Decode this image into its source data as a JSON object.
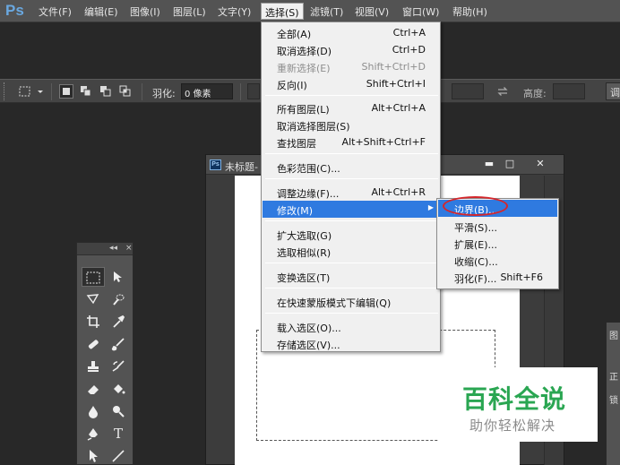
{
  "app": {
    "logo": "Ps"
  },
  "menubar": {
    "items": [
      "文件(F)",
      "编辑(E)",
      "图像(I)",
      "图层(L)",
      "文字(Y)",
      "选择(S)",
      "滤镜(T)",
      "视图(V)",
      "窗口(W)",
      "帮助(H)"
    ],
    "active": "选择(S)"
  },
  "options_bar": {
    "feather_label": "羽化:",
    "feather_value": "0 像素",
    "height_label": "高度:",
    "button_label": "调"
  },
  "document": {
    "title": "未标题-",
    "min_glyph": "▬",
    "max_glyph": "□",
    "close_glyph": "✕"
  },
  "tools_panel": {
    "collapse_glyph": "◂◂",
    "close_glyph": "×"
  },
  "right_panel": {
    "labels": [
      "图",
      "正",
      "锁"
    ]
  },
  "select_menu": {
    "items": [
      {
        "label": "全部(A)",
        "shortcut": "Ctrl+A"
      },
      {
        "label": "取消选择(D)",
        "shortcut": "Ctrl+D"
      },
      {
        "label": "重新选择(E)",
        "shortcut": "Shift+Ctrl+D",
        "disabled": true
      },
      {
        "label": "反向(I)",
        "shortcut": "Shift+Ctrl+I"
      },
      {
        "label": "所有图层(L)",
        "shortcut": "Alt+Ctrl+A"
      },
      {
        "label": "取消选择图层(S)",
        "shortcut": ""
      },
      {
        "label": "查找图层",
        "shortcut": "Alt+Shift+Ctrl+F"
      },
      {
        "label": "色彩范围(C)...",
        "shortcut": ""
      },
      {
        "label": "调整边缘(F)...",
        "shortcut": "Alt+Ctrl+R"
      },
      {
        "label": "修改(M)",
        "shortcut": "",
        "highlight": true,
        "submenu": true
      },
      {
        "label": "扩大选取(G)",
        "shortcut": ""
      },
      {
        "label": "选取相似(R)",
        "shortcut": ""
      },
      {
        "label": "变换选区(T)",
        "shortcut": ""
      },
      {
        "label": "在快速蒙版模式下编辑(Q)",
        "shortcut": ""
      },
      {
        "label": "载入选区(O)...",
        "shortcut": ""
      },
      {
        "label": "存储选区(V)...",
        "shortcut": ""
      }
    ]
  },
  "modify_submenu": {
    "items": [
      {
        "label": "边界(B)...",
        "shortcut": "",
        "highlight": true
      },
      {
        "label": "平滑(S)...",
        "shortcut": ""
      },
      {
        "label": "扩展(E)...",
        "shortcut": ""
      },
      {
        "label": "收缩(C)...",
        "shortcut": ""
      },
      {
        "label": "羽化(F)...",
        "shortcut": "Shift+F6"
      }
    ]
  },
  "watermark": {
    "title": "百科全说",
    "subtitle": "助你轻松解决"
  },
  "colors": {
    "highlight": "#2f7ae0",
    "annotation_circle": "#d4262b",
    "watermark_green": "#2aa652"
  }
}
